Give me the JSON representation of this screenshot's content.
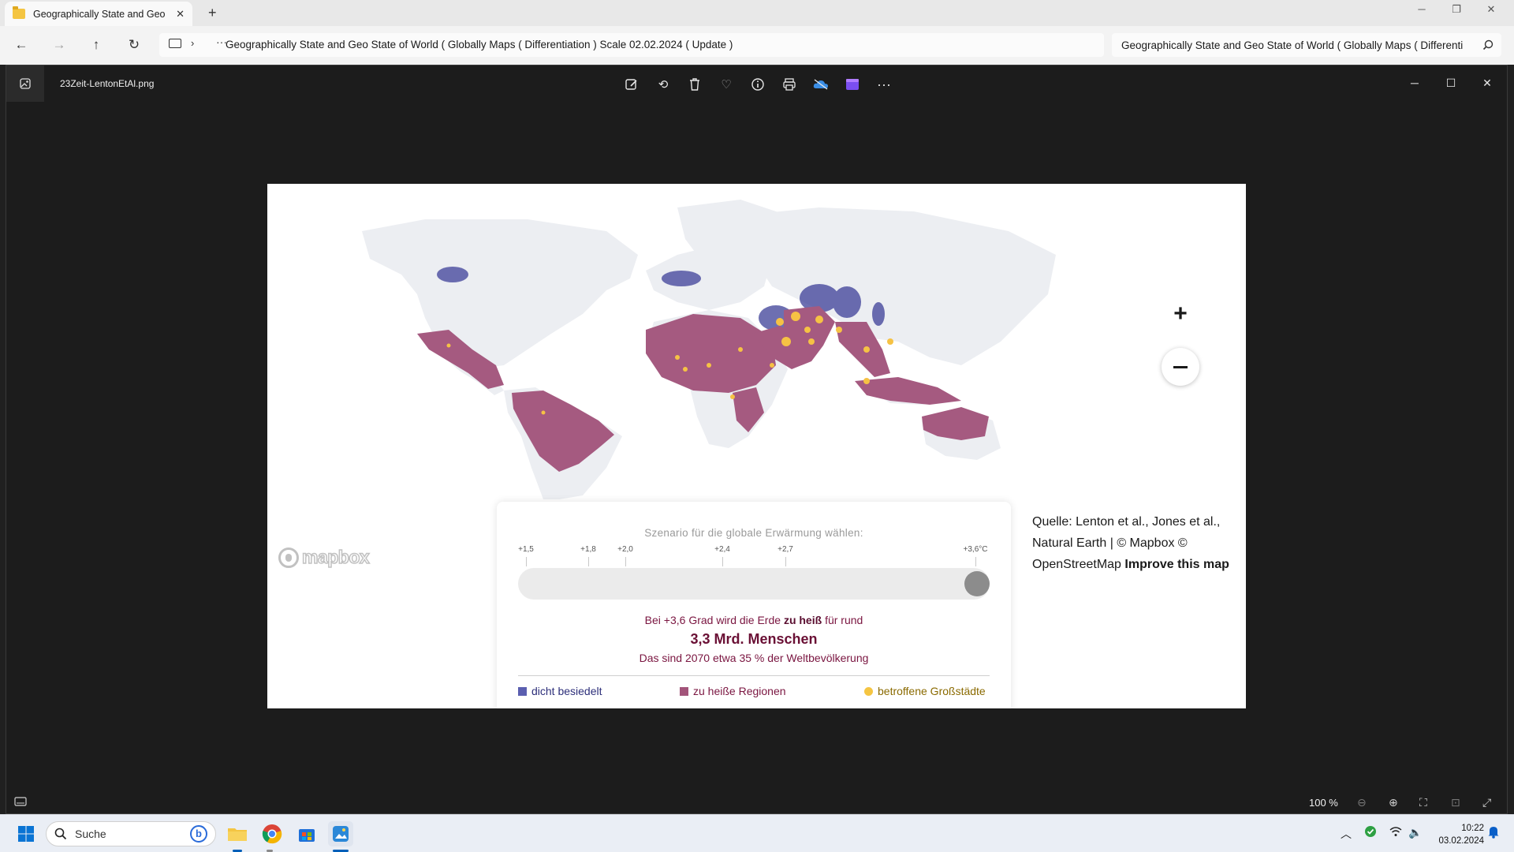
{
  "explorer": {
    "tab_title": "Geographically State and Geo",
    "address_text": "Geographically State and Geo State of World ( Globally Maps ( Differentiation ) Scale 02.02.2024 ( Update )",
    "search_text": "Geographically State and Geo State of World ( Globally Maps ( Differenti"
  },
  "viewer": {
    "file_name": "23Zeit-LentonEtAl.png",
    "zoom_level": "100 %"
  },
  "map": {
    "attribution_line1": "Quelle: Lenton et al., Jones et al.,",
    "attribution_line2": "Natural Earth | © Mapbox ©",
    "attribution_line3": "OpenStreetMap",
    "attribution_improve": "Improve this map",
    "mapbox_logo_text": "mapbox"
  },
  "panel": {
    "title": "Szenario für die globale Erwärmung wählen:",
    "ticks": [
      "+1,5",
      "+1,8",
      "+2,0",
      "+2,4",
      "+2,7",
      "+3,6°C"
    ],
    "selected_scenario": "+3,6°C",
    "result_prefix": "Bei +3,6 Grad wird die Erde",
    "result_bold": "zu heiß",
    "result_suffix": "für rund",
    "result_big": "3,3 Mrd. Menschen",
    "result_sub": "Das sind 2070 etwa 35 % der Weltbevölkerung",
    "legend": [
      {
        "label": "dicht besiedelt",
        "color": "#5b5fb0"
      },
      {
        "label": "zu heiße Regionen",
        "color": "#a2547a"
      },
      {
        "label": "betroffene Großstädte",
        "color": "#f5c542"
      }
    ]
  },
  "taskbar": {
    "search_label": "Suche",
    "time": "10:22",
    "date": "03.02.2024"
  },
  "colors": {
    "hot_region": "#a55a80",
    "dense": "#3d3f98",
    "city": "#f6c244",
    "land": "#eceef2",
    "accent": "#005fb8"
  }
}
